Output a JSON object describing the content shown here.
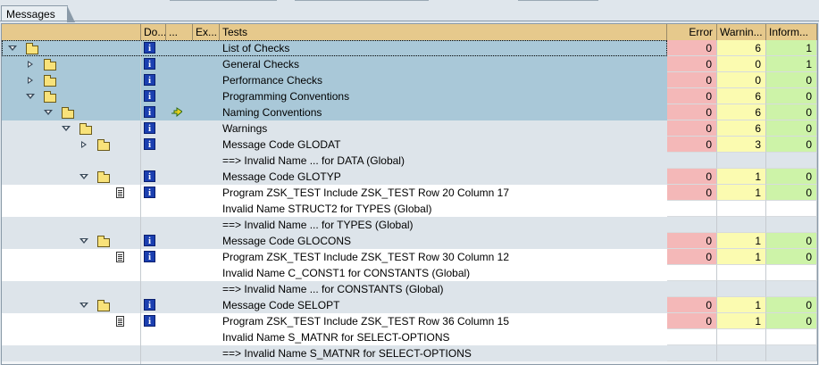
{
  "tab": {
    "title": "Messages"
  },
  "columns": {
    "do": "Do...",
    "dots": "...",
    "ex": "Ex...",
    "tests": "Tests",
    "error": "Error",
    "warning": "Warnin...",
    "info": "Inform..."
  },
  "colors": {
    "error": "#f4b8b8",
    "warning": "#fbfbb0",
    "info": "#cdf3a8",
    "selected": "#a9c8d8",
    "header": "#e6c98c"
  },
  "rows": [
    {
      "level": 0,
      "expander": "down",
      "icon": "folder",
      "info": true,
      "text": "List of Checks",
      "error": "0",
      "warning": "6",
      "inform": "1",
      "style": "sel"
    },
    {
      "level": 1,
      "expander": "right",
      "icon": "folder",
      "info": true,
      "text": "General Checks",
      "error": "0",
      "warning": "0",
      "inform": "1",
      "style": "sel"
    },
    {
      "level": 1,
      "expander": "right",
      "icon": "folder",
      "info": true,
      "text": "Performance Checks",
      "error": "0",
      "warning": "0",
      "inform": "0",
      "style": "sel"
    },
    {
      "level": 1,
      "expander": "down",
      "icon": "folder",
      "info": true,
      "text": "Programming Conventions",
      "error": "0",
      "warning": "6",
      "inform": "0",
      "style": "sel"
    },
    {
      "level": 2,
      "expander": "down",
      "icon": "folder",
      "info": true,
      "arrow": true,
      "text": "Naming Conventions",
      "error": "0",
      "warning": "6",
      "inform": "0",
      "style": "sel"
    },
    {
      "level": 3,
      "expander": "down",
      "icon": "folder",
      "info": true,
      "text": "Warnings",
      "error": "0",
      "warning": "6",
      "inform": "0",
      "style": "plain"
    },
    {
      "level": 4,
      "expander": "right",
      "icon": "folder",
      "info": true,
      "text": "Message Code GLODAT",
      "error": "0",
      "warning": "3",
      "inform": "0",
      "style": "plain"
    },
    {
      "level": 5,
      "expander": "",
      "icon": "",
      "info": false,
      "text": "==> Invalid Name ... for DATA (Global)",
      "error": "",
      "warning": "",
      "inform": "",
      "style": "plain"
    },
    {
      "level": 4,
      "expander": "down",
      "icon": "folder",
      "info": true,
      "text": "Message Code GLOTYP",
      "error": "0",
      "warning": "1",
      "inform": "0",
      "style": "plain"
    },
    {
      "level": 5,
      "expander": "",
      "icon": "doc",
      "info": true,
      "text": "Program ZSK_TEST Include ZSK_TEST Row 20 Column 17",
      "error": "0",
      "warning": "1",
      "inform": "0",
      "style": "white"
    },
    {
      "level": 5,
      "expander": "",
      "icon": "",
      "info": false,
      "text": "Invalid Name STRUCT2 for TYPES (Global)",
      "error": "",
      "warning": "",
      "inform": "",
      "style": "white"
    },
    {
      "level": 5,
      "expander": "",
      "icon": "",
      "info": false,
      "text": "==> Invalid Name ... for TYPES (Global)",
      "error": "",
      "warning": "",
      "inform": "",
      "style": "plain"
    },
    {
      "level": 4,
      "expander": "down",
      "icon": "folder",
      "info": true,
      "text": "Message Code GLOCONS",
      "error": "0",
      "warning": "1",
      "inform": "0",
      "style": "plain"
    },
    {
      "level": 5,
      "expander": "",
      "icon": "doc",
      "info": true,
      "text": "Program ZSK_TEST Include ZSK_TEST Row 30 Column 12",
      "error": "0",
      "warning": "1",
      "inform": "0",
      "style": "white"
    },
    {
      "level": 5,
      "expander": "",
      "icon": "",
      "info": false,
      "text": "Invalid Name C_CONST1 for CONSTANTS (Global)",
      "error": "",
      "warning": "",
      "inform": "",
      "style": "white"
    },
    {
      "level": 5,
      "expander": "",
      "icon": "",
      "info": false,
      "text": "==> Invalid Name ... for CONSTANTS (Global)",
      "error": "",
      "warning": "",
      "inform": "",
      "style": "plain"
    },
    {
      "level": 4,
      "expander": "down",
      "icon": "folder",
      "info": true,
      "text": "Message Code SELOPT",
      "error": "0",
      "warning": "1",
      "inform": "0",
      "style": "plain"
    },
    {
      "level": 5,
      "expander": "",
      "icon": "doc",
      "info": true,
      "text": "Program ZSK_TEST Include ZSK_TEST Row 36 Column 15",
      "error": "0",
      "warning": "1",
      "inform": "0",
      "style": "white"
    },
    {
      "level": 5,
      "expander": "",
      "icon": "",
      "info": false,
      "text": "Invalid Name S_MATNR for SELECT-OPTIONS",
      "error": "",
      "warning": "",
      "inform": "",
      "style": "white"
    },
    {
      "level": 5,
      "expander": "",
      "icon": "",
      "info": false,
      "text": "==> Invalid Name S_MATNR for SELECT-OPTIONS",
      "error": "",
      "warning": "",
      "inform": "",
      "style": "plain"
    }
  ]
}
